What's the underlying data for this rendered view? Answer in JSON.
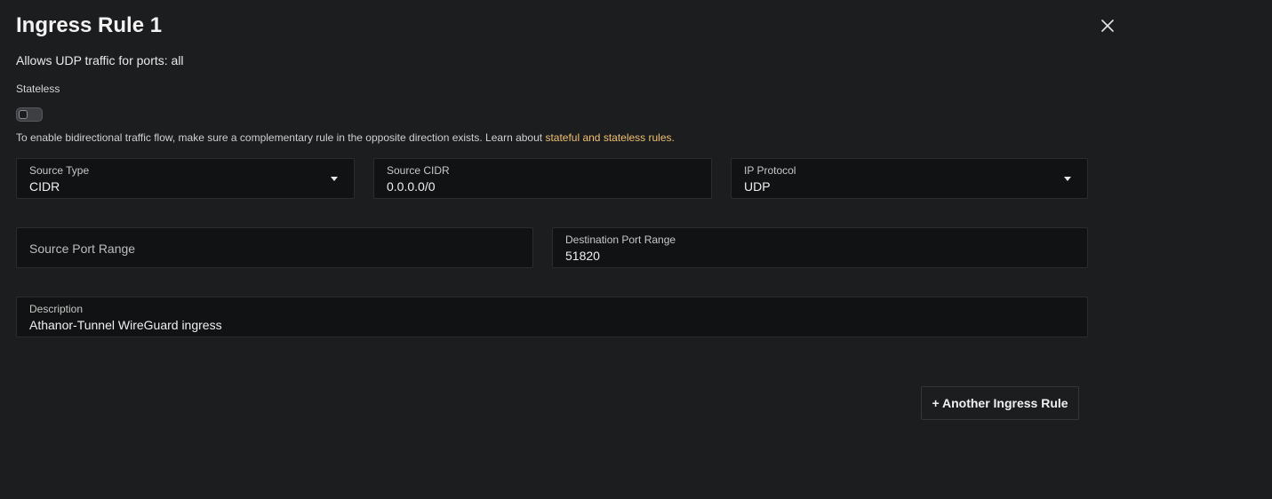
{
  "header": {
    "title": "Ingress Rule 1",
    "close_icon": "close-icon"
  },
  "summary": "Allows UDP traffic for ports: all",
  "stateless": {
    "label": "Stateless",
    "enabled": false
  },
  "help": {
    "text": "To enable bidirectional traffic flow, make sure a complementary rule in the opposite direction exists. Learn about ",
    "link_text": "stateful and stateless rules."
  },
  "fields": {
    "source_type": {
      "label": "Source Type",
      "value": "CIDR"
    },
    "source_cidr": {
      "label": "Source CIDR",
      "value": "0.0.0.0/0"
    },
    "ip_protocol": {
      "label": "IP Protocol",
      "value": "UDP"
    },
    "source_port_range": {
      "placeholder": "Source Port Range"
    },
    "destination_port_range": {
      "label": "Destination Port Range",
      "value": "51820"
    },
    "description": {
      "label": "Description",
      "value": "Athanor-Tunnel WireGuard ingress"
    }
  },
  "actions": {
    "add_rule_label": "+ Another Ingress Rule"
  },
  "colors": {
    "background": "#1c1d1f",
    "field_background": "#111213",
    "link": "#f0c170"
  }
}
